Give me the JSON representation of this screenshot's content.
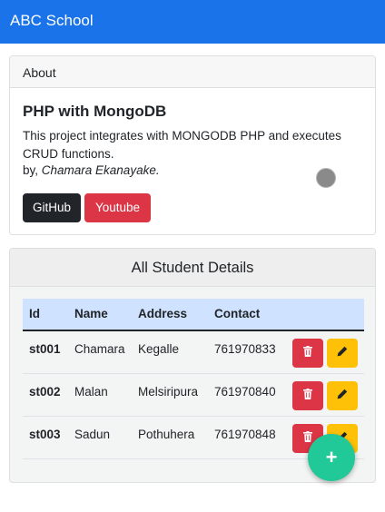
{
  "navbar": {
    "brand": "ABC School"
  },
  "about": {
    "header": "About",
    "title": "PHP with MongoDB",
    "description": "This project integrates with MONGODB PHP and executes CRUD functions.",
    "by_prefix": "by, ",
    "author": "Chamara Ekanayake.",
    "github_label": "GitHub",
    "youtube_label": "Youtube"
  },
  "students": {
    "header": "All Student Details",
    "columns": {
      "id": "Id",
      "name": "Name",
      "address": "Address",
      "contact": "Contact"
    },
    "rows": [
      {
        "id": "st001",
        "name": "Chamara",
        "address": "Kegalle",
        "contact": "761970833"
      },
      {
        "id": "st002",
        "name": "Malan",
        "address": "Melsiripura",
        "contact": "761970840"
      },
      {
        "id": "st003",
        "name": "Sadun",
        "address": "Pothuhera",
        "contact": "761970848"
      }
    ],
    "delete_icon": "trash-icon",
    "edit_icon": "pencil-icon"
  },
  "fab": {
    "icon": "plus-icon",
    "glyph": "+"
  },
  "colors": {
    "navbar": "#1a73e8",
    "table_header": "#cfe2ff",
    "danger": "#dc3545",
    "warning": "#ffc107",
    "dark": "#212529",
    "fab": "#20c997"
  }
}
